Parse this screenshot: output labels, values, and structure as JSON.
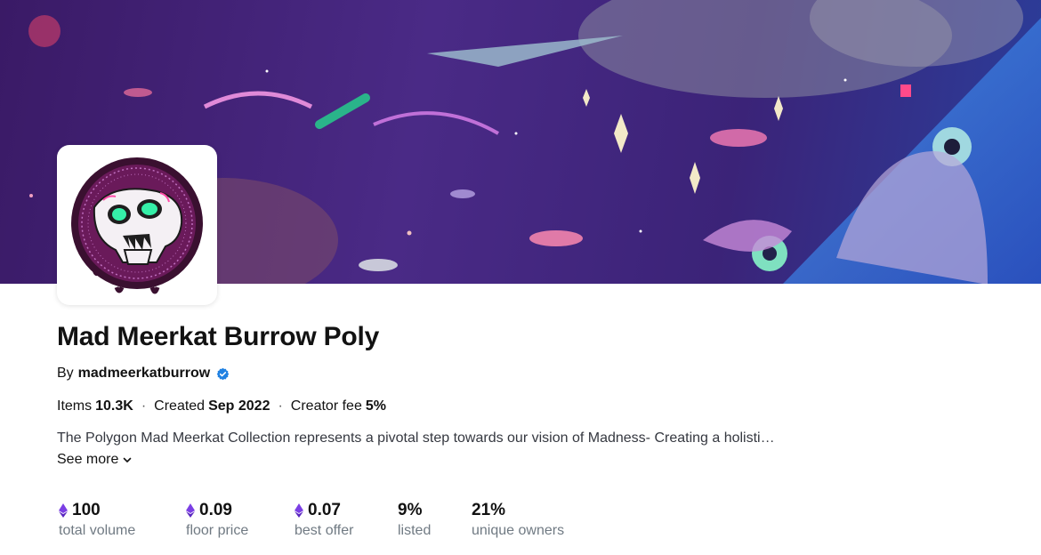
{
  "collection": {
    "title": "Mad Meerkat Burrow Poly",
    "by_label": "By",
    "creator": "madmeerkatburrow",
    "items_label": "Items",
    "items_value": "10.3K",
    "created_label": "Created",
    "created_value": "Sep 2022",
    "fee_label": "Creator fee",
    "fee_value": "5%",
    "description": "The Polygon Mad Meerkat Collection represents a pivotal step towards our vision of Madness- Creating a holisti…",
    "see_more": "See more"
  },
  "stats": [
    {
      "value": "100",
      "label": "total volume",
      "eth": true
    },
    {
      "value": "0.09",
      "label": "floor price",
      "eth": true
    },
    {
      "value": "0.07",
      "label": "best offer",
      "eth": true
    },
    {
      "value": "9%",
      "label": "listed",
      "eth": false
    },
    {
      "value": "21%",
      "label": "unique owners",
      "eth": false
    }
  ],
  "icons": {
    "verified": "verified-badge-icon",
    "eth": "ethereum-icon",
    "chevron": "chevron-down-icon"
  },
  "colors": {
    "verified": "#2081e2",
    "eth": "#7b3fe4",
    "banner_base": "#3a1a66"
  }
}
